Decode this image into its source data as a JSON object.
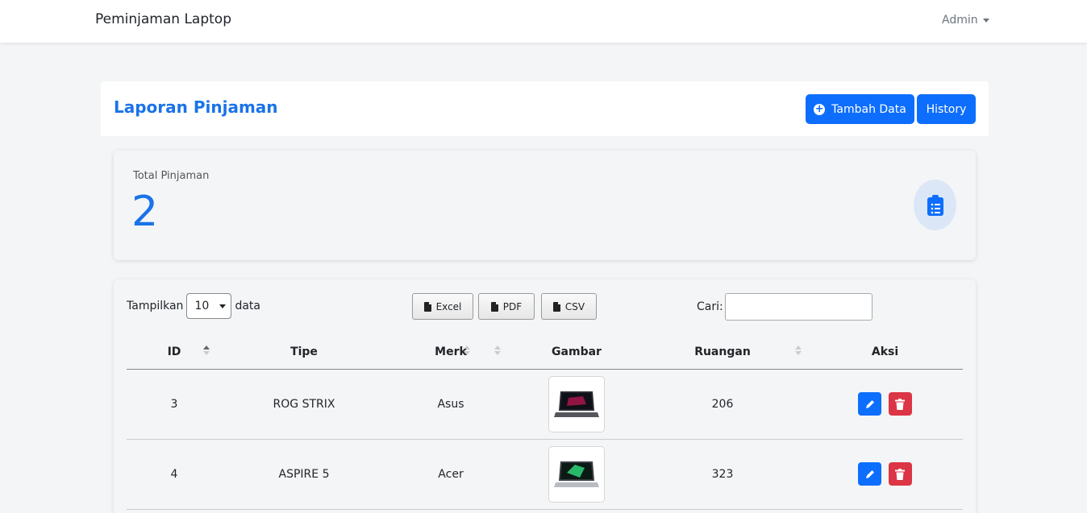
{
  "navbar": {
    "brand": "Peminjaman Laptop",
    "user": "Admin"
  },
  "header": {
    "title": "Laporan Pinjaman",
    "add_label": "Tambah Data",
    "history_label": "History"
  },
  "stat": {
    "label": "Total Pinjaman",
    "value": "2",
    "icon": "clipboard-list-icon"
  },
  "table_controls": {
    "show_prefix": "Tampilkan",
    "show_value": "10",
    "show_suffix": "data",
    "export_excel": "Excel",
    "export_pdf": "PDF",
    "export_csv": "CSV",
    "search_label": "Cari:",
    "search_value": ""
  },
  "columns": [
    "ID",
    "Tipe",
    "Merk",
    "Gambar",
    "Ruangan",
    "Aksi"
  ],
  "rows": [
    {
      "id": "3",
      "tipe": "ROG STRIX",
      "merk": "Asus",
      "ruangan": "206"
    },
    {
      "id": "4",
      "tipe": "ASPIRE 5",
      "merk": "Acer",
      "ruangan": "323"
    }
  ],
  "colors": {
    "primary": "#0d6efd",
    "title": "#1a73e8",
    "danger": "#dc3545"
  }
}
